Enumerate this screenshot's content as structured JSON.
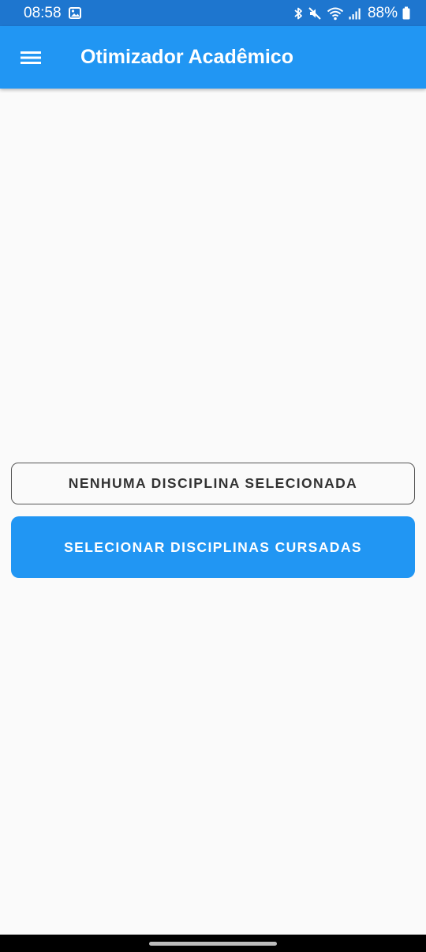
{
  "status_bar": {
    "time": "08:58",
    "battery": "88%",
    "icons": [
      "image-notification-icon",
      "bluetooth-icon",
      "mute-icon",
      "wifi-icon",
      "signal-icon",
      "battery-icon"
    ]
  },
  "app_bar": {
    "title": "Otimizador Acadêmico",
    "menu_icon": "hamburger-menu-icon"
  },
  "content": {
    "selected_label": "NENHUMA DISCIPLINA SELECIONADA",
    "select_button_label": "SELECIONAR DISCIPLINAS CURSADAS"
  },
  "colors": {
    "status_bar": "#1e76cf",
    "primary": "#2196f3",
    "background": "#fafafa",
    "outline": "#555555"
  }
}
